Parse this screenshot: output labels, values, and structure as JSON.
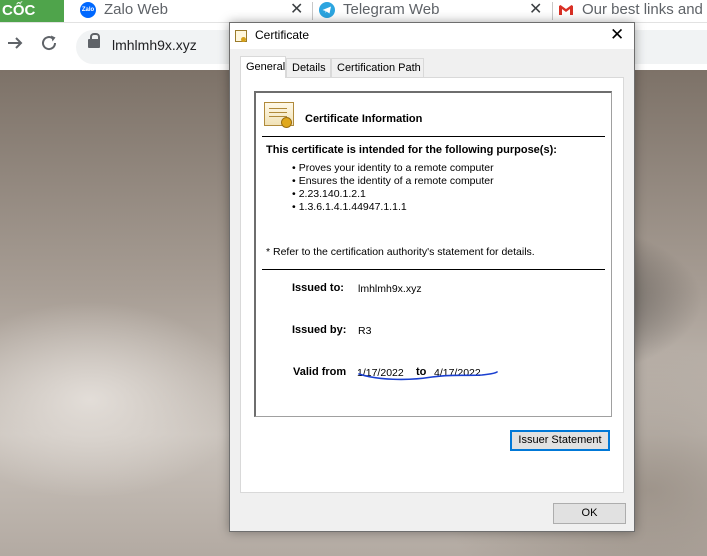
{
  "browser": {
    "brand": "CỐC CỐC",
    "tabs": [
      {
        "label": "Zalo Web",
        "favicon_text": "Zalo",
        "favicon_color": "#0068ff"
      },
      {
        "label": "Telegram Web",
        "favicon_color": "#2ca5e0"
      },
      {
        "label": "Our best links and to",
        "favicon_color": "#d93025"
      }
    ],
    "close_glyph": "✕",
    "url": "lmhlmh9x.xyz"
  },
  "dialog": {
    "title": "Certificate",
    "close_glyph": "✕",
    "tabs": [
      "General",
      "Details",
      "Certification Path"
    ],
    "active_tab": "General",
    "cert_info_title": "Certificate Information",
    "purpose_heading": "This certificate is intended for the following purpose(s):",
    "purposes": [
      "Proves your identity to a remote computer",
      "Ensures the identity of a remote computer",
      "2.23.140.1.2.1",
      "1.3.6.1.4.1.44947.1.1.1"
    ],
    "refer_note": "* Refer to the certification authority's statement for details.",
    "issued_to_label": "Issued to:",
    "issued_to": "lmhlmh9x.xyz",
    "issued_by_label": "Issued by:",
    "issued_by": "R3",
    "valid_from_label": "Valid from",
    "valid_from": "1/17/2022",
    "to_label": "to",
    "valid_to": "4/17/2022",
    "issuer_statement_button": "Issuer Statement",
    "ok_button": "OK",
    "annotation_color": "#1a3fd0"
  }
}
